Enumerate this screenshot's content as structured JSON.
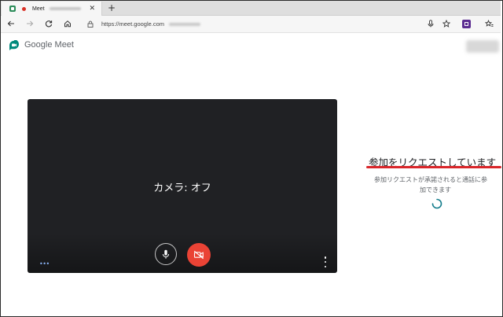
{
  "browser": {
    "tab": {
      "title": "Meet"
    },
    "address_bar": {
      "url": "https://meet.google.com"
    }
  },
  "meet": {
    "app_name": "Google Meet",
    "preview": {
      "camera_status": "カメラ: オフ"
    },
    "join_panel": {
      "title": "参加をリクエストしています",
      "description_line1": "参加リクエストが承諾されると通話に参",
      "description_line2": "加できます"
    }
  },
  "colors": {
    "brand_green": "#00897b",
    "camera_off_red": "#ea4335",
    "highlight_red": "#d9262a",
    "spinner_teal": "#1a73e8"
  },
  "icons": [
    "back-icon",
    "forward-icon",
    "reload-icon",
    "home-icon",
    "lock-icon",
    "mic-icon",
    "camera-off-icon",
    "star-icon",
    "favorites-icon",
    "more-vert-icon"
  ]
}
